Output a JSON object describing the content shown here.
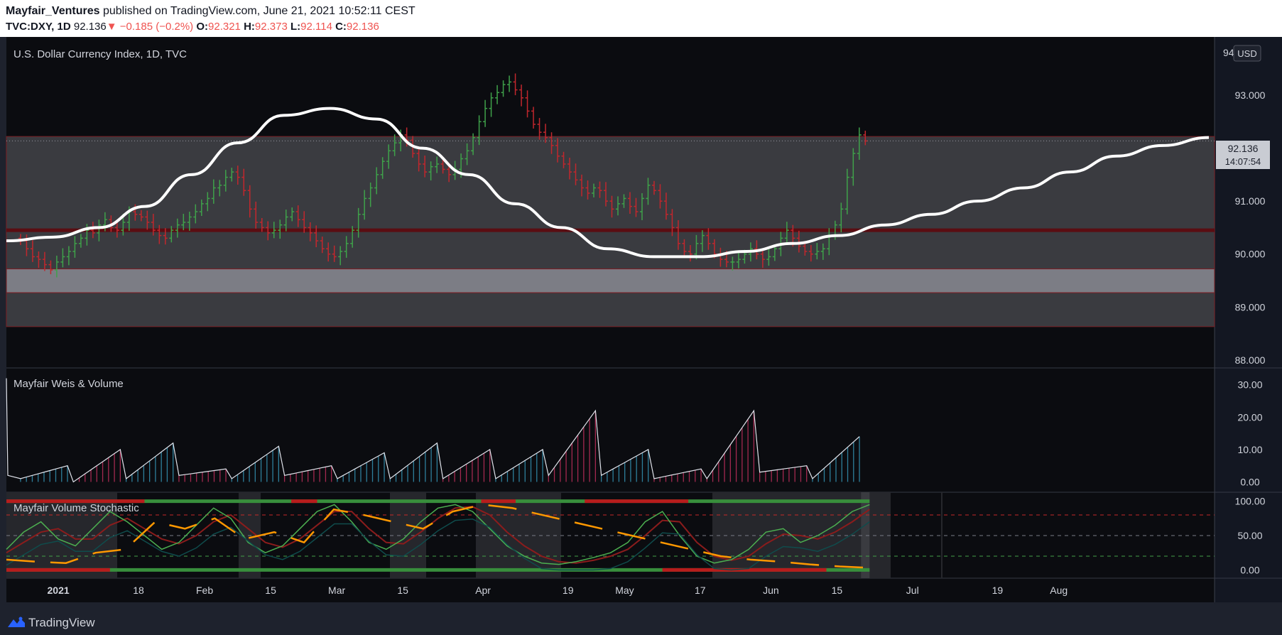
{
  "header": {
    "author": "Mayfair_Ventures",
    "published": "published on TradingView.com, June 21, 2021 10:52:11 CEST",
    "symbol": "TVC:DXY, 1D",
    "price": "92.136",
    "change": "▼ −0.185 (−0.2%)",
    "o_label": "O:",
    "o_value": "92.321",
    "h_label": "H:",
    "h_value": "92.373",
    "l_label": "L:",
    "l_value": "92.114",
    "c_label": "C:",
    "c_value": "92.136"
  },
  "price_pane": {
    "title": "U.S. Dollar Currency Index, 1D, TVC",
    "currency": "USD",
    "last_price": "92.136",
    "countdown": "14:07:54",
    "top_tick_partial": "94"
  },
  "weis_pane": {
    "title": "Mayfair Weis & Volume"
  },
  "stoch_pane": {
    "title": "Mayfair Volume Stochastic"
  },
  "x_axis": {
    "labels": [
      "2021",
      "18",
      "Feb",
      "15",
      "Mar",
      "15",
      "Apr",
      "19",
      "May",
      "17",
      "Jun",
      "15",
      "Jul",
      "19",
      "Aug"
    ],
    "bold_label": "2021"
  },
  "footer": {
    "brand": "TradingView"
  },
  "colors": {
    "background": "#0d0e12",
    "up": "#3fa14a",
    "down": "#c1272d",
    "ma": "#ffffff",
    "zone": "#3a3b40",
    "support_band": "#7c7d85",
    "weis_up": "#2e7f9b",
    "weis_down": "#a3294f",
    "stoch_orange": "#ff9800",
    "stoch_green": "#388e3c",
    "stoch_red": "#b71c1c"
  },
  "chart_data": [
    {
      "type": "bar",
      "name": "DXY daily OHLC",
      "y_ticks": [
        88.0,
        89.0,
        90.0,
        91.0,
        92.0,
        93.0
      ],
      "y_tick_labels": [
        "88.000",
        "89.000",
        "90.000",
        "91.000",
        "92.000",
        "93.000"
      ],
      "ylim": [
        87.85,
        94.1
      ],
      "date_range": [
        "2020-12-24",
        "2021-06-21"
      ],
      "zones": [
        {
          "from": 89.72,
          "to": 92.22,
          "color": "zone"
        },
        {
          "from": 89.27,
          "to": 89.72,
          "color": "support_band"
        },
        {
          "from": 88.63,
          "to": 89.27,
          "color": "zone"
        }
      ],
      "lines": [
        {
          "y": 90.45,
          "color": "red"
        },
        {
          "y": 92.136,
          "style": "dotted"
        }
      ],
      "closes": [
        90.25,
        90.1,
        89.95,
        89.9,
        89.8,
        89.7,
        89.85,
        89.95,
        90.05,
        90.2,
        90.3,
        90.45,
        90.4,
        90.55,
        90.65,
        90.5,
        90.45,
        90.6,
        90.8,
        90.75,
        90.7,
        90.6,
        90.45,
        90.35,
        90.3,
        90.45,
        90.55,
        90.6,
        90.7,
        90.8,
        90.95,
        91.05,
        91.25,
        91.3,
        91.45,
        91.55,
        91.45,
        91.2,
        90.85,
        90.6,
        90.5,
        90.4,
        90.45,
        90.55,
        90.7,
        90.8,
        90.65,
        90.5,
        90.4,
        90.25,
        90.1,
        90.0,
        89.95,
        90.05,
        90.2,
        90.45,
        90.75,
        91.05,
        91.25,
        91.5,
        91.75,
        91.95,
        92.1,
        92.25,
        92.15,
        91.9,
        91.7,
        91.55,
        91.65,
        91.7,
        91.6,
        91.5,
        91.6,
        91.8,
        91.95,
        92.2,
        92.5,
        92.75,
        92.95,
        93.05,
        93.2,
        93.25,
        93.1,
        92.95,
        92.7,
        92.45,
        92.3,
        92.2,
        92.05,
        91.85,
        91.7,
        91.55,
        91.4,
        91.25,
        91.15,
        91.25,
        91.2,
        91.0,
        90.85,
        90.95,
        91.05,
        90.9,
        90.8,
        91.05,
        91.3,
        91.2,
        91.0,
        90.75,
        90.5,
        90.2,
        90.05,
        90.0,
        90.2,
        90.35,
        90.2,
        90.0,
        89.9,
        89.85,
        89.85,
        89.9,
        90.0,
        90.1,
        90.0,
        89.9,
        89.95,
        90.1,
        90.3,
        90.45,
        90.3,
        90.15,
        90.05,
        90.0,
        90.05,
        90.1,
        90.35,
        90.55,
        90.85,
        91.45,
        91.9,
        92.25,
        92.136
      ],
      "moving_average": [
        90.25,
        90.32,
        90.5,
        90.9,
        91.5,
        92.1,
        92.62,
        92.75,
        92.55,
        92.0,
        91.5,
        90.95,
        90.5,
        90.1,
        89.95,
        89.95,
        90.05,
        90.2,
        90.35,
        90.55,
        90.75,
        91.0,
        91.25,
        91.55,
        91.85,
        92.05,
        92.2
      ]
    },
    {
      "type": "bar",
      "name": "Mayfair Weis & Volume",
      "y_ticks": [
        0,
        10,
        20,
        30
      ],
      "y_tick_labels": [
        "0.00",
        "10.00",
        "20.00",
        "30.00"
      ],
      "ylim": [
        -1,
        33
      ],
      "waves": [
        {
          "start": 1,
          "peak": 5,
          "dir": "up"
        },
        {
          "start": 0,
          "peak": 10,
          "dir": "down"
        },
        {
          "start": 1,
          "peak": 12,
          "dir": "up"
        },
        {
          "start": 2,
          "peak": 4,
          "dir": "down"
        },
        {
          "start": 1,
          "peak": 11,
          "dir": "up"
        },
        {
          "start": 2,
          "peak": 5,
          "dir": "down"
        },
        {
          "start": 1,
          "peak": 9,
          "dir": "up"
        },
        {
          "start": 1,
          "peak": 12,
          "dir": "up"
        },
        {
          "start": 1,
          "peak": 10,
          "dir": "down"
        },
        {
          "start": 1,
          "peak": 10,
          "dir": "up"
        },
        {
          "start": 2,
          "peak": 22,
          "dir": "down"
        },
        {
          "start": 2,
          "peak": 10,
          "dir": "up"
        },
        {
          "start": 1,
          "peak": 4,
          "dir": "down"
        },
        {
          "start": 1,
          "peak": 22,
          "dir": "down"
        },
        {
          "start": 3,
          "peak": 5,
          "dir": "down"
        },
        {
          "start": 1,
          "peak": 14,
          "dir": "up"
        }
      ]
    },
    {
      "type": "line",
      "name": "Mayfair Volume Stochastic",
      "y_ticks": [
        0,
        50,
        100
      ],
      "y_tick_labels": [
        "0.00",
        "50.00",
        "100.00"
      ],
      "extra_tick": 20,
      "ylim": [
        -12,
        113
      ],
      "levels": [
        80,
        50,
        20
      ],
      "k": [
        30,
        55,
        70,
        45,
        35,
        60,
        85,
        70,
        50,
        30,
        40,
        65,
        90,
        75,
        40,
        25,
        35,
        60,
        85,
        95,
        70,
        40,
        30,
        45,
        70,
        90,
        95,
        85,
        60,
        35,
        20,
        10,
        8,
        12,
        18,
        25,
        40,
        70,
        85,
        50,
        20,
        10,
        15,
        30,
        55,
        60,
        40,
        50,
        65,
        85,
        95
      ],
      "ma": [
        25,
        40,
        55,
        60,
        45,
        45,
        65,
        75,
        60,
        45,
        38,
        50,
        70,
        80,
        60,
        40,
        33,
        45,
        65,
        85,
        85,
        60,
        40,
        38,
        55,
        75,
        90,
        92,
        80,
        55,
        35,
        20,
        12,
        10,
        14,
        20,
        30,
        50,
        72,
        70,
        40,
        20,
        14,
        20,
        38,
        52,
        50,
        45,
        55,
        70,
        88
      ],
      "orange_value": [
        15,
        12,
        10,
        25,
        30,
        70,
        60,
        75,
        45,
        55,
        40,
        88,
        80,
        70,
        60,
        85,
        95,
        90,
        80,
        70,
        60,
        50,
        40,
        30,
        20,
        15,
        12,
        8,
        5,
        3
      ]
    }
  ]
}
